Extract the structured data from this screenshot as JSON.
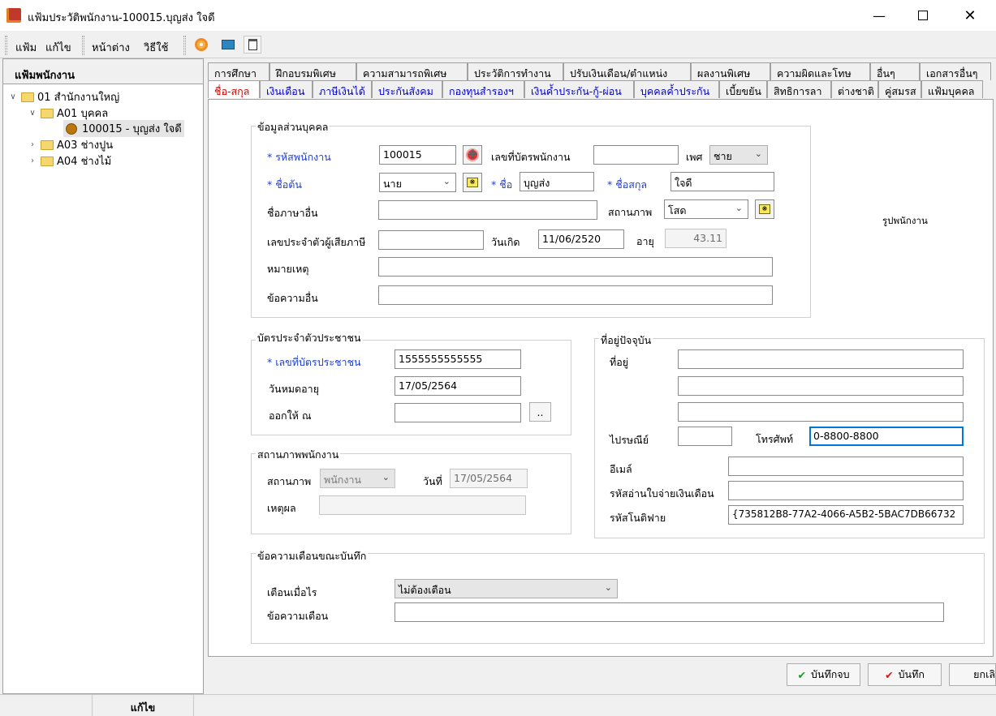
{
  "window": {
    "title": "แฟ้มประวัติพนักงาน-100015.บุญส่ง ใจดี"
  },
  "menu": {
    "file": "แฟ้ม",
    "edit": "แก้ไข",
    "window": "หน้าต่าง",
    "help": "วิธีใช้"
  },
  "left_panel": {
    "header": "แฟ้มพนักงาน",
    "tree": [
      {
        "label": "01 สำนักงานใหญ่"
      },
      {
        "label": "A01 บุคคล"
      },
      {
        "label": "100015 - บุญส่ง ใจดี"
      },
      {
        "label": "A03 ช่างปูน"
      },
      {
        "label": "A04 ช่างไม้"
      }
    ]
  },
  "tabs_top": [
    "การศึกษา",
    "ฝึกอบรมพิเศษ",
    "ความสามารถพิเศษ",
    "ประวัติการทำงาน",
    "ปรับเงินเดือน/ตำแหน่ง",
    "ผลงานพิเศษ",
    "ความผิดและโทษ",
    "อื่นๆ",
    "เอกสารอื่นๆ"
  ],
  "tabs_bottom": [
    "ชื่อ-สกุล",
    "เงินเดือน",
    "ภาษีเงินได้",
    "ประกันสังคม",
    "กองทุนสำรองฯ",
    "เงินค้ำประกัน-กู้-ผ่อน",
    "บุคคลค้ำประกัน",
    "เบี้ยขยัน",
    "สิทธิการลา",
    "ต่างชาติ",
    "คู่สมรส",
    "แฟ้มบุคคล"
  ],
  "personal": {
    "title": "ข้อมูลส่วนบุคคล",
    "emp_code_label": "* รหัสพนักงาน",
    "emp_code": "100015",
    "card_no_label": "เลขที่บัตรพนักงาน",
    "card_no": "",
    "gender_label": "เพศ",
    "gender": "ชาย",
    "prefix_label": "* ชื่อต้น",
    "prefix": "นาย",
    "name_label": "* ชื่อ",
    "name": "บุญส่ง",
    "surname_label": "* ชื่อสกุล",
    "surname": "ใจดี",
    "other_lang_label": "ชื่อภาษาอื่น",
    "other_lang": "",
    "status_label": "สถานภาพ",
    "status": "โสด",
    "tax_id_label": "เลขประจำตัวผู้เสียภาษี",
    "tax_id": "",
    "birth_label": "วันเกิด",
    "birth": "11/06/2520",
    "age_label": "อายุ",
    "age": "43.11",
    "remark_label": "หมายเหตุ",
    "remark": "",
    "other_msg_label": "ข้อความอื่น",
    "other_msg": "",
    "photo_label": "รูปพนักงาน"
  },
  "idcard": {
    "title": "บัตรประจำตัวประชาชน",
    "no_label": "* เลขที่บัตรประชาชน",
    "no": "1555555555555",
    "expire_label": "วันหมดอายุ",
    "expire": "17/05/2564",
    "issued_label": "ออกให้ ณ",
    "issued": "",
    "browse": ".."
  },
  "emp_status": {
    "title": "สถานภาพพนักงาน",
    "status_label": "สถานภาพ",
    "status": "พนักงาน",
    "date_label": "วันที่",
    "date": "17/05/2564",
    "reason_label": "เหตุผล",
    "reason": ""
  },
  "address": {
    "title": "ที่อยู่ปัจจุบัน",
    "addr_label": "ที่อยู่",
    "line1": "",
    "line2": "",
    "line3": "",
    "zip_label": "ไปรษณีย์",
    "zip": "",
    "phone_label": "โทรศัพท์",
    "phone": "0-8800-8800",
    "email_label": "อีเมล์",
    "email": "",
    "payslip_label": "รหัสอ่านใบจ่ายเงินเดือน",
    "payslip": "",
    "notify_label": "รหัสโนติฟาย",
    "notify": "{735812B8-77A2-4066-A5B2-5BAC7DB66732"
  },
  "alert": {
    "title": "ข้อความเตือนขณะบันทึก",
    "when_label": "เตือนเมื่อไร",
    "when": "ไม่ต้องเตือน",
    "msg_label": "ข้อความเตือน",
    "msg": ""
  },
  "buttons": {
    "save_close": "บันทึกจบ",
    "save": "บันทึก",
    "cancel": "ยกเลิ"
  },
  "statusbar": {
    "edit": "แก้ไข"
  }
}
